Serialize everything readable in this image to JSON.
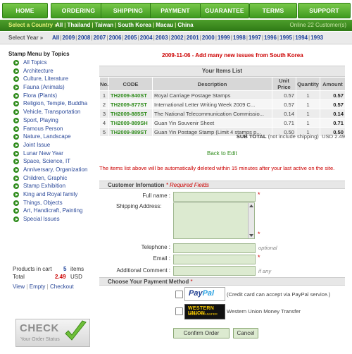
{
  "nav": {
    "items": [
      "HOME",
      "ORDERING",
      "SHIPPING",
      "PAYMENT",
      "GUARANTEE",
      "TERMS",
      "SUPPORT"
    ]
  },
  "countrybar": {
    "label": "Select a Country »",
    "countries": [
      "All",
      "Thailand",
      "Taiwan",
      "South Korea",
      "Macau",
      "China"
    ],
    "online": "Online 22 Customer(s)"
  },
  "yearbar": {
    "label": "Select Year »",
    "years": [
      "All",
      "2009",
      "2008",
      "2007",
      "2006",
      "2005",
      "2004",
      "2003",
      "2002",
      "2001",
      "2000",
      "1999",
      "1998",
      "1997",
      "1996",
      "1995",
      "1994",
      "1993"
    ]
  },
  "menu": {
    "title": "Stamp Menu by Topics",
    "items": [
      "All Topics",
      "Architecture",
      "Culture, Literature",
      "Fauna (Animals)",
      "Flora (Plants)",
      "Religion, Temple, Buddha",
      "Vehicle, Transportation",
      "Sport, Playing",
      "Famous Person",
      "Nature, Landscape",
      "Joint Issue",
      "Lunar New Year",
      "Space, Science, IT",
      "Anniversary, Organization",
      "Children, Graphic",
      "Stamp Exhibition",
      "King and Royal family",
      "Things, Objects",
      "Art, Handicraft, Painting",
      "Special Issues"
    ]
  },
  "cart": {
    "products_label": "Products in cart",
    "count": "5",
    "items_label": "items",
    "total_label": "Total",
    "total_value": "2.49",
    "currency": "USD",
    "view": "View",
    "empty": "Empty",
    "checkout": "Checkout",
    "sep": "|"
  },
  "check_status": {
    "big": "CHECK",
    "small": "Your Order Status"
  },
  "news": "2009-11-06 - Add many new issues from South Korea",
  "items": {
    "title": "Your Items List",
    "headers": [
      "No.",
      "CODE",
      "Description",
      "Unit Price",
      "Quantity",
      "Amount"
    ],
    "rows": [
      {
        "no": "1",
        "code": "TH2009-840ST",
        "desc": "Royal Carriage Postage Stamps",
        "price": "0.57",
        "qty": "1",
        "amount": "0.57"
      },
      {
        "no": "2",
        "code": "TH2009-877ST",
        "desc": "International Letter Writing Week 2009 C...",
        "price": "0.57",
        "qty": "1",
        "amount": "0.57"
      },
      {
        "no": "3",
        "code": "TH2009-885ST",
        "desc": "The National Telecommunication Commissio...",
        "price": "0.14",
        "qty": "1",
        "amount": "0.14"
      },
      {
        "no": "4",
        "code": "TH2009-889SH",
        "desc": "Guan Yin Souvenir Sheet",
        "price": "0.71",
        "qty": "1",
        "amount": "0.71"
      },
      {
        "no": "5",
        "code": "TH2009-889ST",
        "desc": "Guan Yin Postage Stamp (Limit 4 stamps p...",
        "price": "0.50",
        "qty": "1",
        "amount": "0.50"
      }
    ],
    "subtotal_label": "SUB TOTAL",
    "subtotal_note": "(not include shipping)",
    "subtotal_value": "USD 2.49"
  },
  "back_to_edit": "Back to Edit",
  "warning": "The items list above will be automatically deleted within 15 minutes after your last active on the site.",
  "customer": {
    "title": "Customer Infomation",
    "required": "* Required Fields",
    "full_name": "Full name :",
    "shipping_address": "Shipping Address:",
    "telephone": "Telephone :",
    "telephone_note": "optional",
    "email": "Email :",
    "comment": "Additional Comment :",
    "comment_note": "if any",
    "star": "*"
  },
  "payment": {
    "title": "Choose Your Payment Method",
    "required": "*",
    "paypal_text": "(Credit card can accept via PayPal service.)",
    "paypal_logo_a": "Pay",
    "paypal_logo_b": "Pal",
    "wu_logo": "WESTERN UNION",
    "wu_sub": "MONEY TRANSFER",
    "wu_text": "Western Union Money Transfer"
  },
  "buttons": {
    "confirm": "Confirm Order",
    "cancel": "Cancel"
  },
  "colors": {
    "green": "#3f9a1f",
    "red": "#cc0000",
    "link": "#1a3f99"
  }
}
